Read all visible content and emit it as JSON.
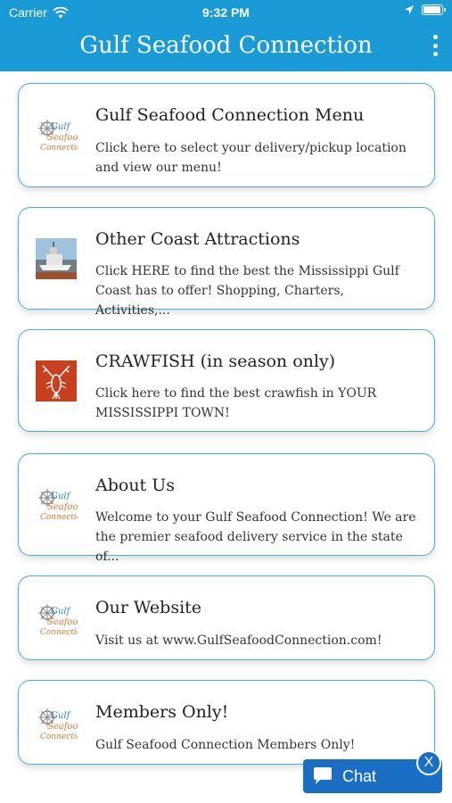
{
  "status": {
    "carrier": "Carrier",
    "time": "9:32 PM"
  },
  "header": {
    "title": "Gulf Seafood Connection"
  },
  "items": [
    {
      "title": "Gulf Seafood Connection Menu",
      "desc": "Click here to select your delivery/pickup location and view our menu!",
      "icon": "logo"
    },
    {
      "title": "Other Coast Attractions",
      "desc": "Click HERE to find the best the Mississippi Gulf Coast has to offer! Shopping, Charters, Activities,...",
      "icon": "boat-photo"
    },
    {
      "title": "CRAWFISH (in season only)",
      "desc": "Click here to find the best crawfish in YOUR MISSISSIPPI TOWN!",
      "icon": "crawfish"
    },
    {
      "title": "About Us",
      "desc": "Welcome to your Gulf Seafood Connection! We are the premier seafood delivery service in the state of...",
      "icon": "logo"
    },
    {
      "title": "Our Website",
      "desc": "Visit us at www.GulfSeafoodConnection.com!",
      "icon": "logo"
    },
    {
      "title": "Members Only!",
      "desc": "Gulf Seafood Connection Members Only!",
      "icon": "logo"
    }
  ],
  "chat": {
    "label": "Chat",
    "close": "X"
  },
  "colors": {
    "brand": "#1a9bd7",
    "card_border": "#43b0e0",
    "chat": "#1a6fc4",
    "crawfish_bg": "#c8401e"
  }
}
